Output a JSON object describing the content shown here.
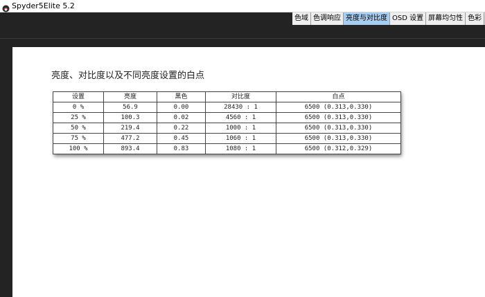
{
  "window": {
    "title": "Spyder5Elite 5.2",
    "app_icon": "spyder-logo-icon"
  },
  "tabs": [
    {
      "label": "色域",
      "active": false
    },
    {
      "label": "色调响应",
      "active": false
    },
    {
      "label": "亮度与对比度",
      "active": true
    },
    {
      "label": "OSD 设置",
      "active": false
    },
    {
      "label": "屏幕均匀性",
      "active": false
    },
    {
      "label": "色彩",
      "active": false
    }
  ],
  "content": {
    "heading": "亮度、对比度以及不同亮度设置的白点",
    "table": {
      "headers": [
        "设置",
        "亮度",
        "黑色",
        "对比度",
        "白点"
      ],
      "rows": [
        [
          "0 %",
          "56.9",
          "0.00",
          "28430 : 1",
          "6500 (0.313,0.330)"
        ],
        [
          "25 %",
          "100.3",
          "0.02",
          "4560 : 1",
          "6500 (0.313,0.330)"
        ],
        [
          "50 %",
          "219.4",
          "0.22",
          "1000 : 1",
          "6500 (0.313,0.330)"
        ],
        [
          "75 %",
          "477.2",
          "0.45",
          "1060 : 1",
          "6500 (0.313,0.330)"
        ],
        [
          "100 %",
          "893.4",
          "0.83",
          "1080 : 1",
          "6500 (0.312,0.329)"
        ]
      ]
    }
  }
}
